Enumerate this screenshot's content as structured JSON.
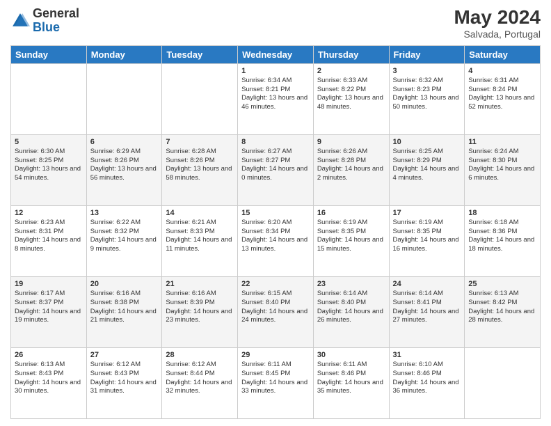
{
  "header": {
    "logo": {
      "general": "General",
      "blue": "Blue"
    },
    "month_year": "May 2024",
    "location": "Salvada, Portugal"
  },
  "weekdays": [
    "Sunday",
    "Monday",
    "Tuesday",
    "Wednesday",
    "Thursday",
    "Friday",
    "Saturday"
  ],
  "weeks": [
    [
      {
        "day": "",
        "sunrise": "",
        "sunset": "",
        "daylight": ""
      },
      {
        "day": "",
        "sunrise": "",
        "sunset": "",
        "daylight": ""
      },
      {
        "day": "",
        "sunrise": "",
        "sunset": "",
        "daylight": ""
      },
      {
        "day": "1",
        "sunrise": "Sunrise: 6:34 AM",
        "sunset": "Sunset: 8:21 PM",
        "daylight": "Daylight: 13 hours and 46 minutes."
      },
      {
        "day": "2",
        "sunrise": "Sunrise: 6:33 AM",
        "sunset": "Sunset: 8:22 PM",
        "daylight": "Daylight: 13 hours and 48 minutes."
      },
      {
        "day": "3",
        "sunrise": "Sunrise: 6:32 AM",
        "sunset": "Sunset: 8:23 PM",
        "daylight": "Daylight: 13 hours and 50 minutes."
      },
      {
        "day": "4",
        "sunrise": "Sunrise: 6:31 AM",
        "sunset": "Sunset: 8:24 PM",
        "daylight": "Daylight: 13 hours and 52 minutes."
      }
    ],
    [
      {
        "day": "5",
        "sunrise": "Sunrise: 6:30 AM",
        "sunset": "Sunset: 8:25 PM",
        "daylight": "Daylight: 13 hours and 54 minutes."
      },
      {
        "day": "6",
        "sunrise": "Sunrise: 6:29 AM",
        "sunset": "Sunset: 8:26 PM",
        "daylight": "Daylight: 13 hours and 56 minutes."
      },
      {
        "day": "7",
        "sunrise": "Sunrise: 6:28 AM",
        "sunset": "Sunset: 8:26 PM",
        "daylight": "Daylight: 13 hours and 58 minutes."
      },
      {
        "day": "8",
        "sunrise": "Sunrise: 6:27 AM",
        "sunset": "Sunset: 8:27 PM",
        "daylight": "Daylight: 14 hours and 0 minutes."
      },
      {
        "day": "9",
        "sunrise": "Sunrise: 6:26 AM",
        "sunset": "Sunset: 8:28 PM",
        "daylight": "Daylight: 14 hours and 2 minutes."
      },
      {
        "day": "10",
        "sunrise": "Sunrise: 6:25 AM",
        "sunset": "Sunset: 8:29 PM",
        "daylight": "Daylight: 14 hours and 4 minutes."
      },
      {
        "day": "11",
        "sunrise": "Sunrise: 6:24 AM",
        "sunset": "Sunset: 8:30 PM",
        "daylight": "Daylight: 14 hours and 6 minutes."
      }
    ],
    [
      {
        "day": "12",
        "sunrise": "Sunrise: 6:23 AM",
        "sunset": "Sunset: 8:31 PM",
        "daylight": "Daylight: 14 hours and 8 minutes."
      },
      {
        "day": "13",
        "sunrise": "Sunrise: 6:22 AM",
        "sunset": "Sunset: 8:32 PM",
        "daylight": "Daylight: 14 hours and 9 minutes."
      },
      {
        "day": "14",
        "sunrise": "Sunrise: 6:21 AM",
        "sunset": "Sunset: 8:33 PM",
        "daylight": "Daylight: 14 hours and 11 minutes."
      },
      {
        "day": "15",
        "sunrise": "Sunrise: 6:20 AM",
        "sunset": "Sunset: 8:34 PM",
        "daylight": "Daylight: 14 hours and 13 minutes."
      },
      {
        "day": "16",
        "sunrise": "Sunrise: 6:19 AM",
        "sunset": "Sunset: 8:35 PM",
        "daylight": "Daylight: 14 hours and 15 minutes."
      },
      {
        "day": "17",
        "sunrise": "Sunrise: 6:19 AM",
        "sunset": "Sunset: 8:35 PM",
        "daylight": "Daylight: 14 hours and 16 minutes."
      },
      {
        "day": "18",
        "sunrise": "Sunrise: 6:18 AM",
        "sunset": "Sunset: 8:36 PM",
        "daylight": "Daylight: 14 hours and 18 minutes."
      }
    ],
    [
      {
        "day": "19",
        "sunrise": "Sunrise: 6:17 AM",
        "sunset": "Sunset: 8:37 PM",
        "daylight": "Daylight: 14 hours and 19 minutes."
      },
      {
        "day": "20",
        "sunrise": "Sunrise: 6:16 AM",
        "sunset": "Sunset: 8:38 PM",
        "daylight": "Daylight: 14 hours and 21 minutes."
      },
      {
        "day": "21",
        "sunrise": "Sunrise: 6:16 AM",
        "sunset": "Sunset: 8:39 PM",
        "daylight": "Daylight: 14 hours and 23 minutes."
      },
      {
        "day": "22",
        "sunrise": "Sunrise: 6:15 AM",
        "sunset": "Sunset: 8:40 PM",
        "daylight": "Daylight: 14 hours and 24 minutes."
      },
      {
        "day": "23",
        "sunrise": "Sunrise: 6:14 AM",
        "sunset": "Sunset: 8:40 PM",
        "daylight": "Daylight: 14 hours and 26 minutes."
      },
      {
        "day": "24",
        "sunrise": "Sunrise: 6:14 AM",
        "sunset": "Sunset: 8:41 PM",
        "daylight": "Daylight: 14 hours and 27 minutes."
      },
      {
        "day": "25",
        "sunrise": "Sunrise: 6:13 AM",
        "sunset": "Sunset: 8:42 PM",
        "daylight": "Daylight: 14 hours and 28 minutes."
      }
    ],
    [
      {
        "day": "26",
        "sunrise": "Sunrise: 6:13 AM",
        "sunset": "Sunset: 8:43 PM",
        "daylight": "Daylight: 14 hours and 30 minutes."
      },
      {
        "day": "27",
        "sunrise": "Sunrise: 6:12 AM",
        "sunset": "Sunset: 8:43 PM",
        "daylight": "Daylight: 14 hours and 31 minutes."
      },
      {
        "day": "28",
        "sunrise": "Sunrise: 6:12 AM",
        "sunset": "Sunset: 8:44 PM",
        "daylight": "Daylight: 14 hours and 32 minutes."
      },
      {
        "day": "29",
        "sunrise": "Sunrise: 6:11 AM",
        "sunset": "Sunset: 8:45 PM",
        "daylight": "Daylight: 14 hours and 33 minutes."
      },
      {
        "day": "30",
        "sunrise": "Sunrise: 6:11 AM",
        "sunset": "Sunset: 8:46 PM",
        "daylight": "Daylight: 14 hours and 35 minutes."
      },
      {
        "day": "31",
        "sunrise": "Sunrise: 6:10 AM",
        "sunset": "Sunset: 8:46 PM",
        "daylight": "Daylight: 14 hours and 36 minutes."
      },
      {
        "day": "",
        "sunrise": "",
        "sunset": "",
        "daylight": ""
      }
    ]
  ]
}
